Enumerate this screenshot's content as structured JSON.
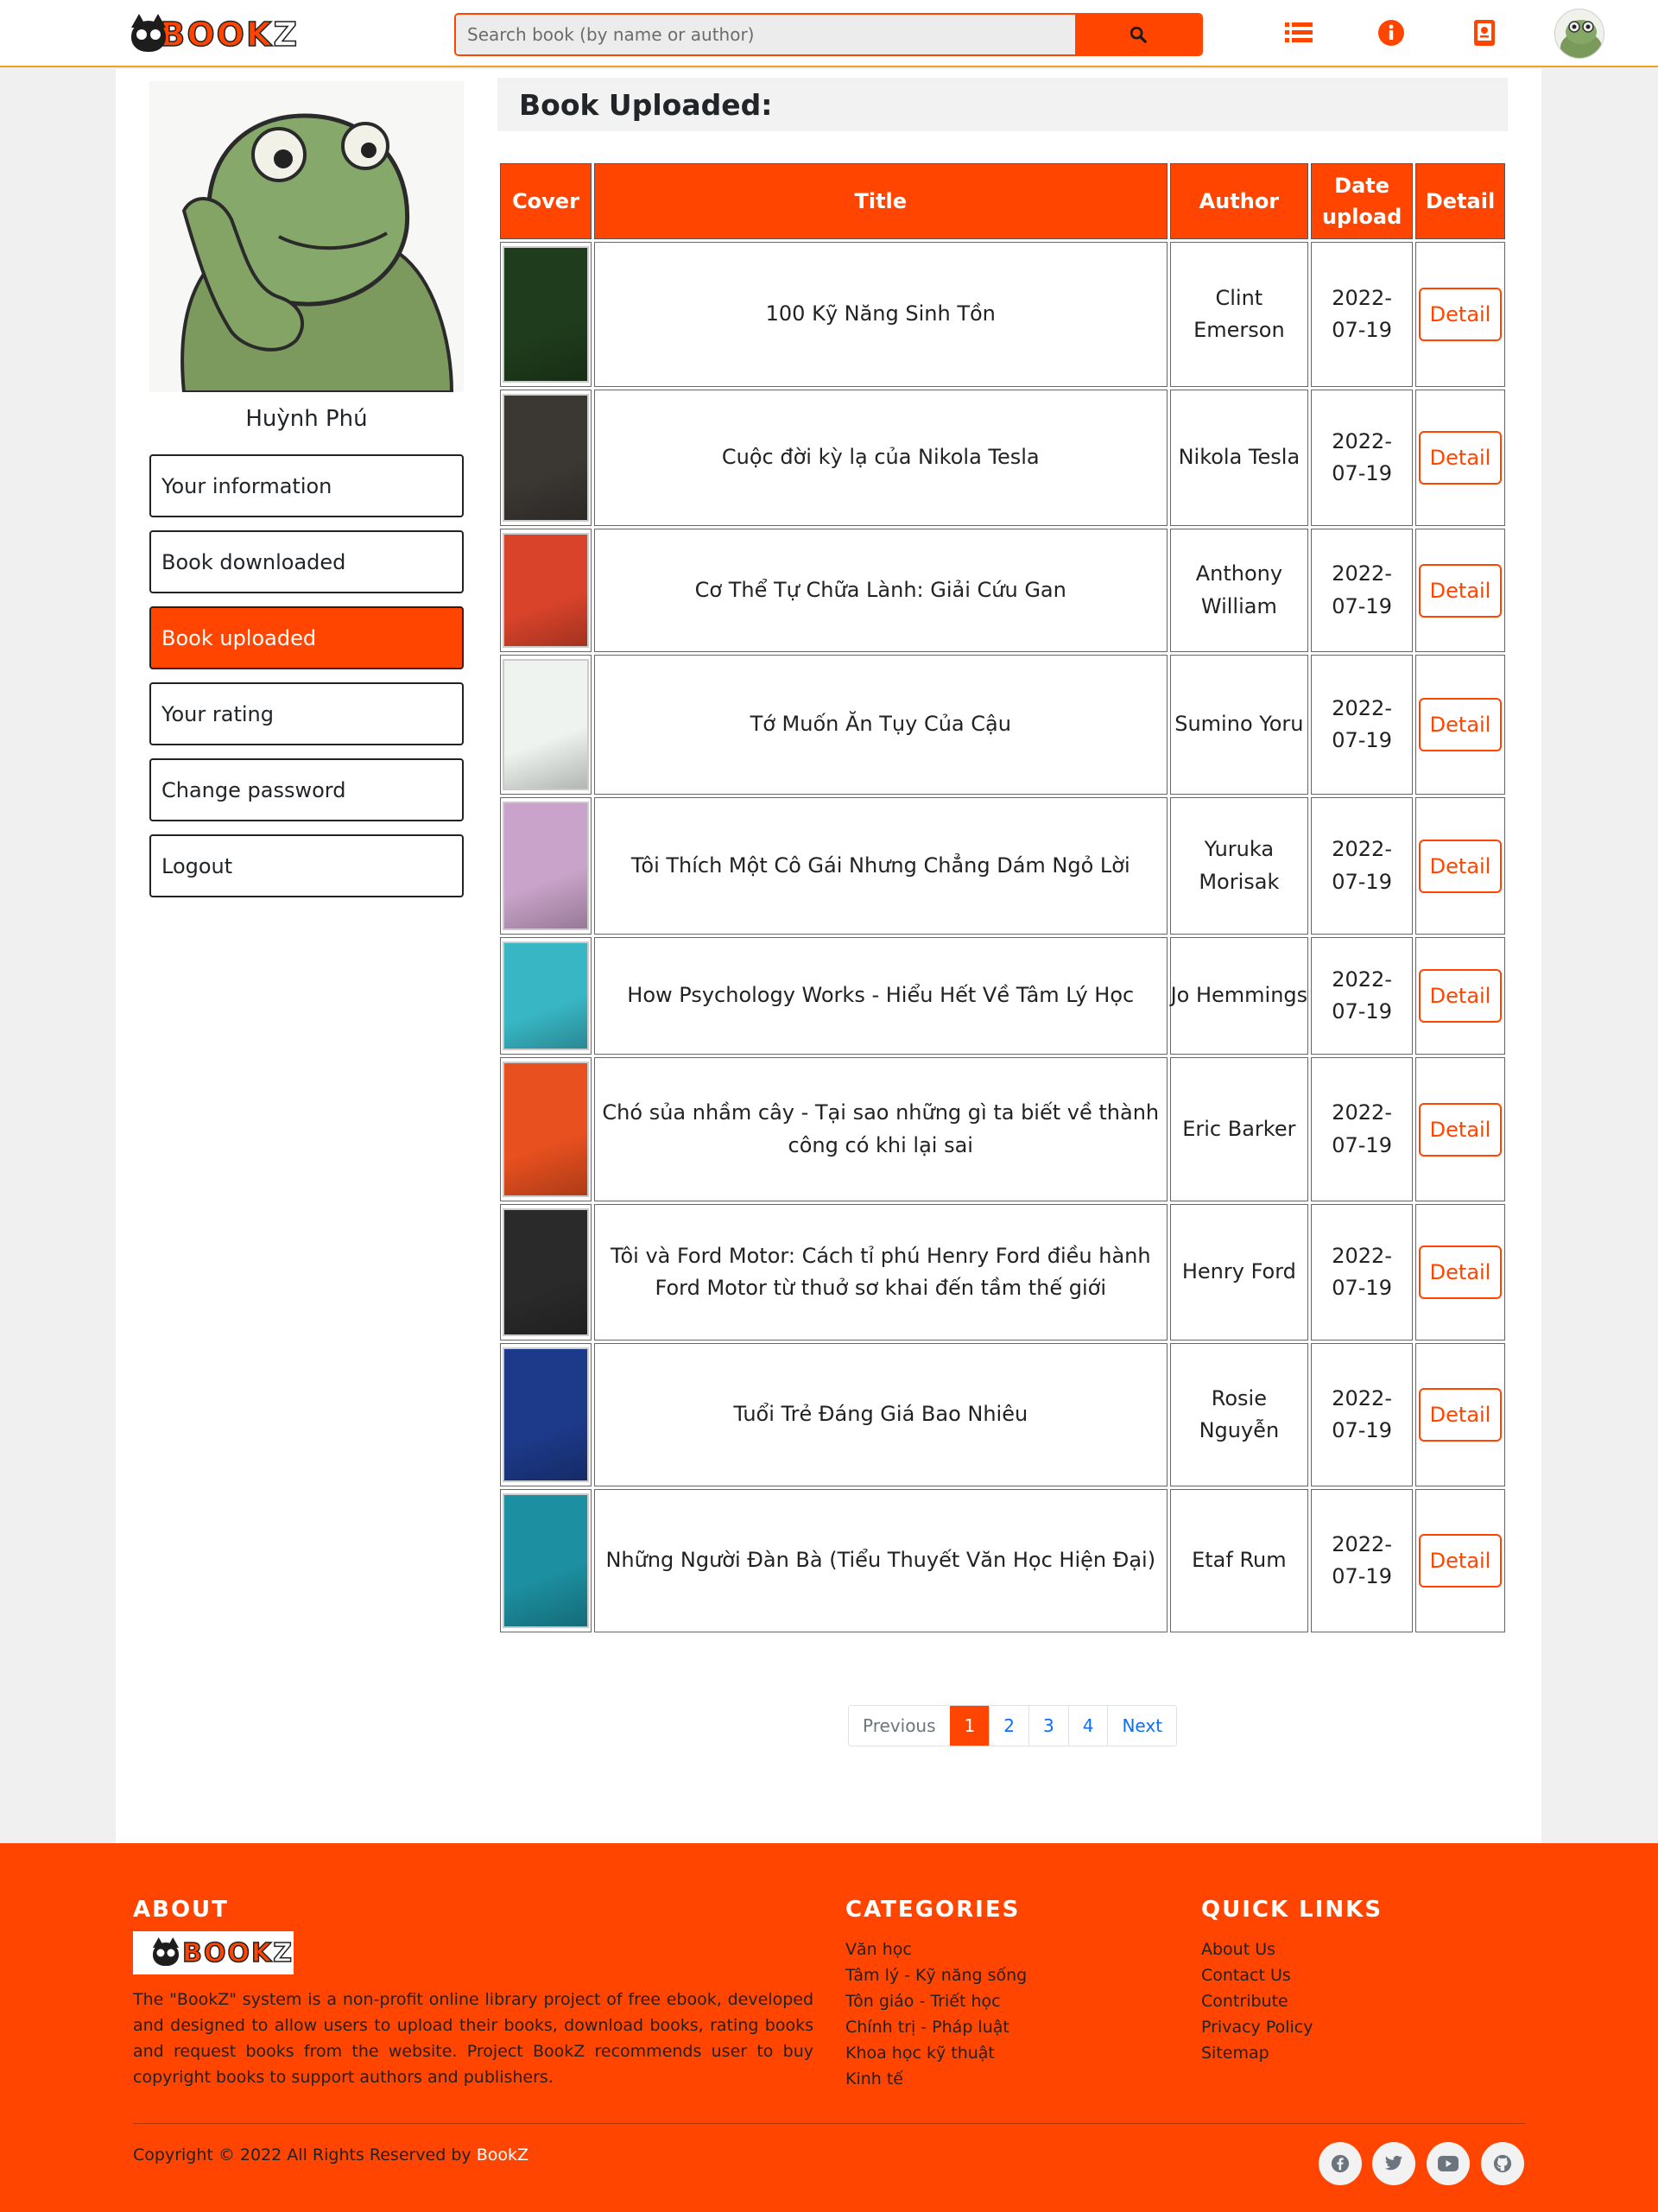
{
  "header": {
    "logo_text_main": "BOOK",
    "logo_text_accent": "Z",
    "search_placeholder": "Search book (by name or author)",
    "icons": [
      "list-icon",
      "info-icon",
      "book-icon",
      "user-avatar"
    ]
  },
  "profile": {
    "name": "Huỳnh Phú"
  },
  "menu": [
    {
      "label": "Your information",
      "active": false
    },
    {
      "label": "Book downloaded",
      "active": false
    },
    {
      "label": "Book uploaded",
      "active": true
    },
    {
      "label": "Your rating",
      "active": false
    },
    {
      "label": "Change password",
      "active": false
    },
    {
      "label": "Logout",
      "active": false
    }
  ],
  "page_title": "Book Uploaded:",
  "table": {
    "headers": {
      "cover": "Cover",
      "title": "Title",
      "author": "Author",
      "date": "Date upload",
      "detail": "Detail"
    },
    "detail_label": "Detail",
    "rows": [
      {
        "title": "100 Kỹ Năng Sinh Tồn",
        "author": "Clint Emerson",
        "date": "2022-07-19",
        "cover_color": "#1f3d1c"
      },
      {
        "title": "Cuộc đời kỳ lạ của Nikola Tesla",
        "author": "Nikola Tesla",
        "date": "2022-07-19",
        "cover_color": "#3b3733"
      },
      {
        "title": "Cơ Thể Tự Chữa Lành: Giải Cứu Gan",
        "author": "Anthony William",
        "date": "2022-07-19",
        "cover_color": "#d9432a"
      },
      {
        "title": "Tớ Muốn Ăn Tụy Của Cậu",
        "author": "Sumino Yoru",
        "date": "2022-07-19",
        "cover_color": "#eef3ef"
      },
      {
        "title": "Tôi Thích Một Cô Gái Nhưng Chẳng Dám Ngỏ Lời",
        "author": "Yuruka Morisak",
        "date": "2022-07-19",
        "cover_color": "#c9a3c9"
      },
      {
        "title": "How Psychology Works - Hiểu Hết Về Tâm Lý Học",
        "author": "Jo Hemmings",
        "date": "2022-07-19",
        "cover_color": "#38b6c4"
      },
      {
        "title": "Chó sủa nhầm cây - Tại sao những gì ta biết về thành công có khi lại sai",
        "author": "Eric Barker",
        "date": "2022-07-19",
        "cover_color": "#e8501f"
      },
      {
        "title": "Tôi và Ford Motor: Cách tỉ phú Henry Ford điều hành Ford Motor từ thuở sơ khai đến tầm thế giới",
        "author": "Henry Ford",
        "date": "2022-07-19",
        "cover_color": "#2a2a2a"
      },
      {
        "title": "Tuổi Trẻ Đáng Giá Bao Nhiêu",
        "author": "Rosie Nguyễn",
        "date": "2022-07-19",
        "cover_color": "#1d3a8a"
      },
      {
        "title": "Những Người Đàn Bà (Tiểu Thuyết Văn Học Hiện Đại)",
        "author": "Etaf Rum",
        "date": "2022-07-19",
        "cover_color": "#1c8fa0"
      }
    ]
  },
  "pagination": {
    "previous": "Previous",
    "pages": [
      "1",
      "2",
      "3",
      "4"
    ],
    "current": "1",
    "next": "Next"
  },
  "footer": {
    "about_heading": "ABOUT",
    "about_text": "The \"BookZ\" system is a non-profit online library project of free ebook, developed and designed to allow users to upload their books, download books, rating books and request books from the website. Project BookZ recommends user to buy copyright books to support authors and publishers.",
    "categories_heading": "CATEGORIES",
    "categories": [
      "Văn học",
      "Tâm lý - Kỹ năng sống",
      "Tôn giáo - Triết học",
      "Chính trị - Pháp luật",
      "Khoa học kỹ thuật",
      "Kinh tế"
    ],
    "quicklinks_heading": "QUICK LINKS",
    "quicklinks": [
      "About Us",
      "Contact Us",
      "Contribute",
      "Privacy Policy",
      "Sitemap"
    ],
    "copyright": "Copyright © 2022 All Rights Reserved by ",
    "copyright_brand": "BookZ",
    "social": [
      "facebook-icon",
      "twitter-icon",
      "youtube-icon",
      "github-icon"
    ]
  },
  "colors": {
    "accent": "#ff4500",
    "active_page": "#ff4500",
    "link": "#0d6efd"
  }
}
